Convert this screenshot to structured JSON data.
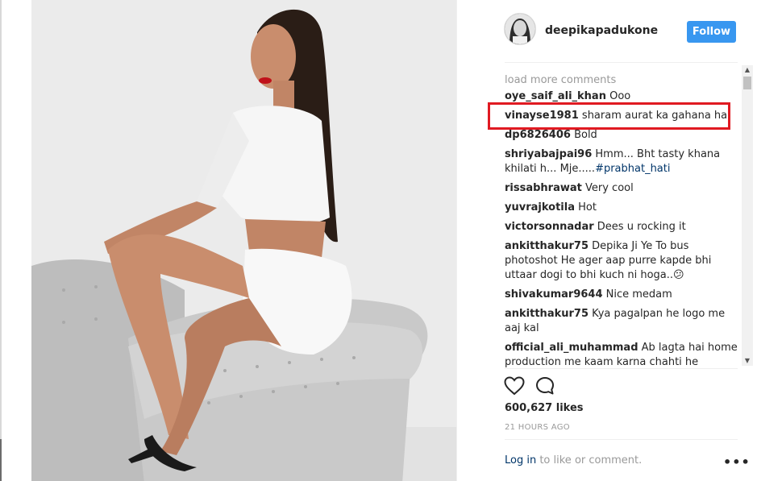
{
  "post": {
    "username": "deepikapadukone",
    "follow_label": "Follow",
    "load_more": "load more comments",
    "comments": [
      {
        "user": "oye_saif_ali_khan",
        "text": "Ooo"
      },
      {
        "user": "vinayse1981",
        "text": "sharam aurat ka gahana hai"
      },
      {
        "user": "dp6826406",
        "text": "Bold"
      },
      {
        "user": "shriyabajpai96",
        "text": "Hmm... Bht tasty khana khilati h... Mje.....",
        "hashtag": "#prabhat_hati"
      },
      {
        "user": "rissabhrawat",
        "text": "Very cool"
      },
      {
        "user": "yuvrajkotila",
        "text": "Hot"
      },
      {
        "user": "victorsonnadar",
        "text": "Dees u rocking it"
      },
      {
        "user": "ankitthakur75",
        "text": "Depika Ji Ye To bus photoshot He ager aap purre kapde bhi uttaar dogi to bhi kuch ni hoga..😕"
      },
      {
        "user": "shivakumar9644",
        "text": "Nice medam"
      },
      {
        "user": "ankitthakur75",
        "text": "Kya pagalpan he logo me aaj kal"
      },
      {
        "user": "official_ali_muhammad",
        "text": "Ab lagta hai home production me kaam karna chahti he"
      }
    ],
    "likes": "600,627 likes",
    "time": "21 HOURS AGO",
    "login_link": "Log in",
    "login_text": " to like or comment.",
    "more": "•••"
  },
  "icons": {
    "like": "heart-icon",
    "comment": "comment-icon",
    "more": "more-options-icon"
  },
  "colors": {
    "follow": "#3897f0",
    "highlight": "#e01a22",
    "muted": "#999999",
    "link": "#003569"
  }
}
